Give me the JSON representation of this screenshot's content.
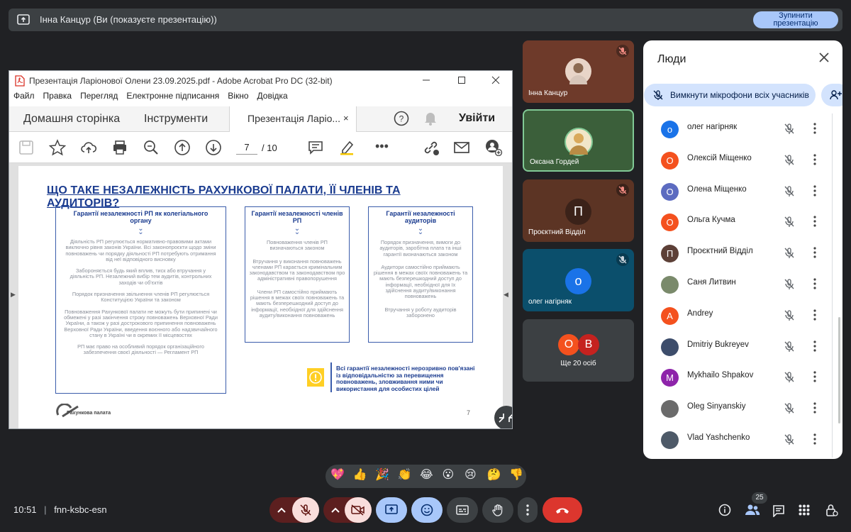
{
  "presenting_bar": {
    "text": "Інна Канцур (Ви (показуєте презентацію))",
    "stop_line1": "Зупинити",
    "stop_line2": "презентацію"
  },
  "acrobat": {
    "title": "Презентація Ларіонової Олени 23.09.2025.pdf - Adobe Acrobat Pro DC (32-bit)",
    "menu": [
      "Файл",
      "Правка",
      "Перегляд",
      "Електронне підписання",
      "Вікно",
      "Довідка"
    ],
    "tab_home": "Домашня сторінка",
    "tab_tools": "Інструменти",
    "tab_doc": "Презентація Ларіо...",
    "login": "Увійти",
    "page_current": "7",
    "page_total": "/ 10"
  },
  "slide": {
    "title": "ЩО ТАКЕ НЕЗАЛЕЖНІСТЬ РАХУНКОВОЇ ПАЛАТИ, ЇЇ ЧЛЕНІВ ТА АУДИТОРІВ?",
    "col1_head": "Гарантії незалежності РП як колегіального органу",
    "col1_p1": "Діяльність РП регулюється нормативно-правовими актами виключно рівня законів України. Всі законопроєкти щодо зміни повноважень чи порядку діяльності РП потребують отримання від неї відповідного висновку",
    "col1_p2": "Забороняється будь який вплив, тиск або втручання у діяльність РП. Незалежний вибір тем аудитів, контрольних заходів чи об'єктів",
    "col1_p3": "Порядок призначення звільнення членів РП регулюється Конституцією України та законом",
    "col1_p4": "Повноваження Рахункової палати не можуть бути припинені чи обмежені у разі закінчення строку повноважень Верховної Ради України, а також у разі дострокового припинення повноважень Верховної Ради України, введення воєнного або надзвичайного стану в Україні чи в окремих її місцевостях",
    "col1_p5": "РП має право на особливий порядок організаційного забезпечення своєї діяльності — Регламент РП",
    "col2_head": "Гарантії незалежності членів РП",
    "col2_p1": "Повноваження членів РП визначаються законом",
    "col2_p2": "Втручання у виконання повноважень членами РП карається кримінальним законодавством та законодавством про адміністративні правопорушення",
    "col2_p3": "Члени РП самостійно приймають рішення в межах своїх повноважень та мають безперешкодний доступ до інформації, необхідної для здійснення аудиту/виконання повноважень",
    "col3_head": "Гарантії незалежності аудиторів",
    "col3_p1": "Порядок призначення, вимоги до аудиторів, заробітна плата та інші гарантії визначаються законом",
    "col3_p2": "Аудитори самостійно приймають рішення в межах своїх повноважень та мають безперешкодний доступ до інформації, необхідної для їх здійснення аудиту/виконання повноважень",
    "col3_p3": "Втручання у роботу аудиторів заборонено",
    "warning": "Всі гарантії незалежності нерозривно пов'язані із відповідальністю за перевищення повноважень, зловживання ними чи використання для особистих цілей",
    "page_number": "7",
    "logo_text": "Рахункова палата"
  },
  "tiles": [
    {
      "name": "Інна Канцур",
      "bg": "#6e3a2a",
      "muted": true
    },
    {
      "name": "Оксана Гордей",
      "bg": "#3b5f3a",
      "muted": false
    },
    {
      "name": "Проєктний Відділ",
      "initial": "П",
      "bg": "#5c3424",
      "muted": true
    },
    {
      "name": "олег нагірняк",
      "initial": "о",
      "bg": "#0b4f6c",
      "muted": true
    },
    {
      "name": "Ще 20 осіб",
      "initials": [
        "О",
        "В"
      ]
    }
  ],
  "people": {
    "title": "Люди",
    "mute_all": "Вимкнути мікрофони всіх учасників",
    "list": [
      {
        "name": "олег нагірняк",
        "initial": "о",
        "color": "#1a73e8"
      },
      {
        "name": "Олексій Міщенко",
        "initial": "О",
        "color": "#f4511e"
      },
      {
        "name": "Олена Міщенко",
        "initial": "О",
        "color": "#5c6bc0"
      },
      {
        "name": "Ольга Кучма",
        "initial": "О",
        "color": "#f4511e"
      },
      {
        "name": "Проєктний Відділ",
        "initial": "П",
        "color": "#5d4037"
      },
      {
        "name": "Саня Литвин",
        "initial": "",
        "color": "#7a8a6b"
      },
      {
        "name": "Andrey",
        "initial": "A",
        "color": "#f4511e"
      },
      {
        "name": "Dmitriy Bukreyev",
        "initial": "",
        "color": "#3d4d6b"
      },
      {
        "name": "Mykhailo Shpakov",
        "initial": "M",
        "color": "#8e24aa"
      },
      {
        "name": "Oleg Sinyanskiy",
        "initial": "",
        "color": "#6b6b6b"
      },
      {
        "name": "Vlad Yashchenko",
        "initial": "",
        "color": "#4e5a68"
      }
    ]
  },
  "reactions": [
    "💖",
    "👍",
    "🎉",
    "👏",
    "😂",
    "😮",
    "😢",
    "🤔",
    "👎"
  ],
  "bottom": {
    "time": "10:51",
    "meeting_code": "fnn-ksbc-esn",
    "people_count": "25"
  }
}
